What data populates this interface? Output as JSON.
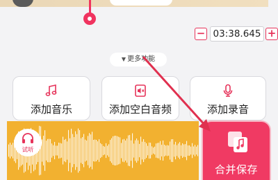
{
  "timeline": {
    "time_value": "03:38.645",
    "minus_label": "−",
    "plus_label": "+"
  },
  "more_functions": {
    "label": "更多功能"
  },
  "functions": [
    {
      "label": "添加音乐",
      "icon": "music-note-icon"
    },
    {
      "label": "添加空白音频",
      "icon": "mute-audio-icon"
    },
    {
      "label": "添加录音",
      "icon": "microphone-icon"
    }
  ],
  "preview": {
    "listen_label": "试听",
    "icon": "headphones-icon"
  },
  "merge_save": {
    "label": "合并保存",
    "icon": "copy-files-icon"
  },
  "colors": {
    "accent": "#f03a63",
    "waveform_bg": "#f2b130",
    "waveform_fg": "#ffffff"
  }
}
